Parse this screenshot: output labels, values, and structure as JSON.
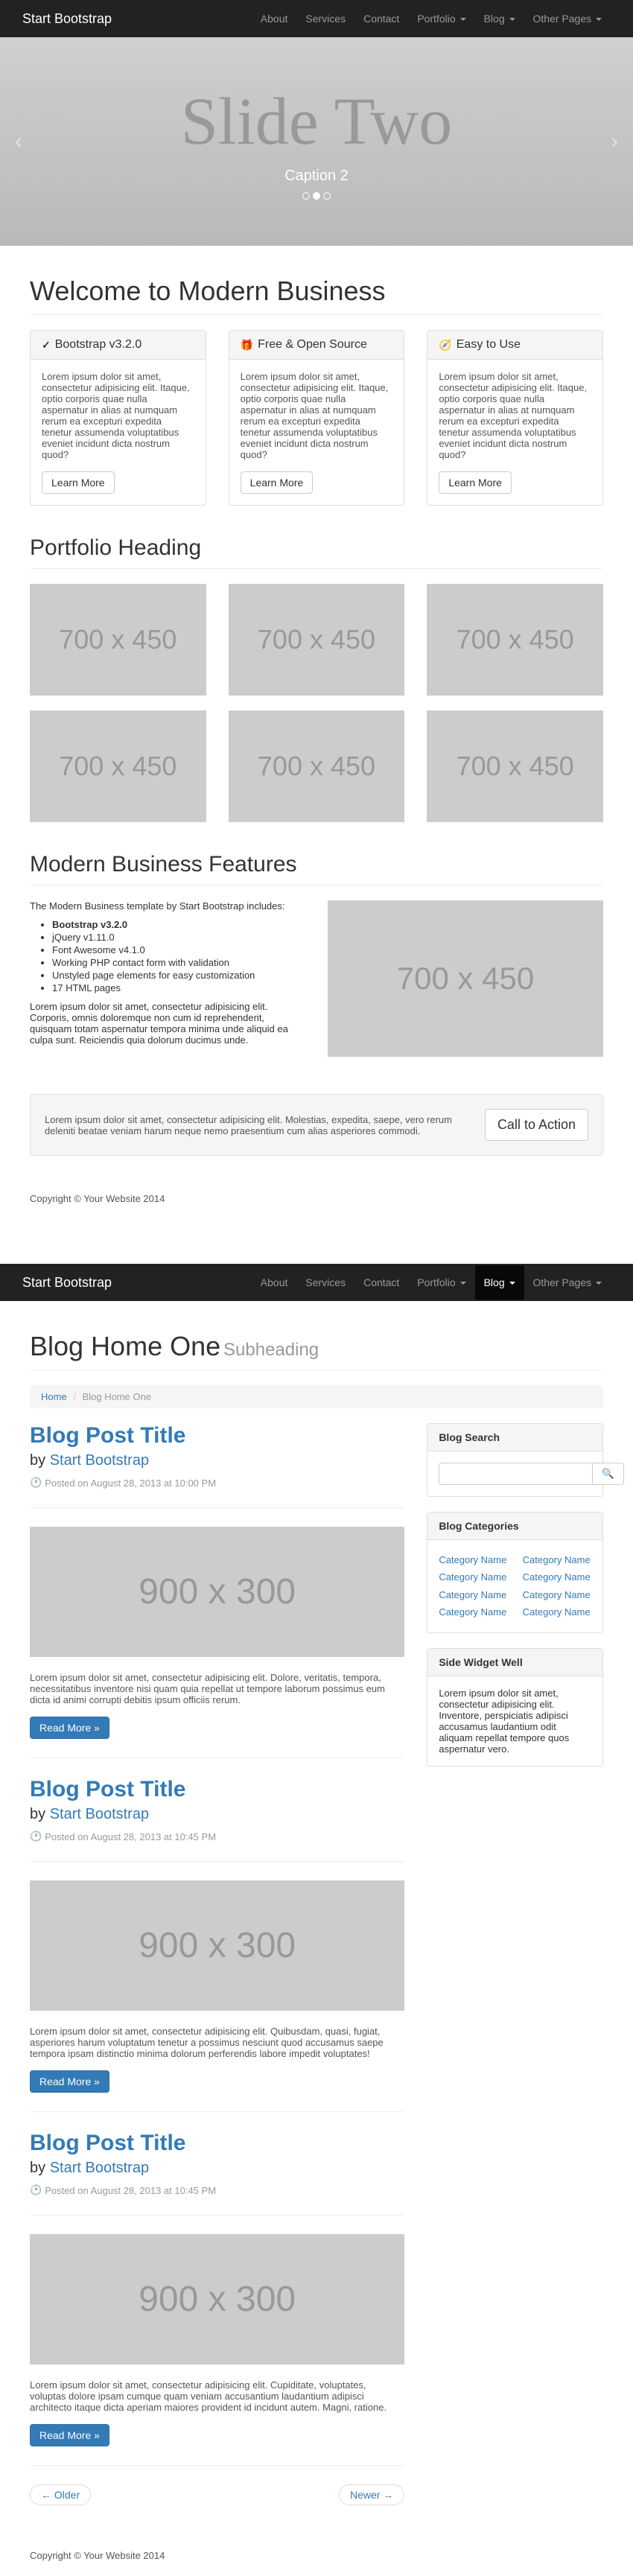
{
  "nav": {
    "brand": "Start Bootstrap",
    "items": [
      "About",
      "Services",
      "Contact",
      "Portfolio",
      "Blog",
      "Other Pages"
    ],
    "active_p1": 4
  },
  "carousel": {
    "title": "Slide Two",
    "caption": "Caption 2"
  },
  "welcome": {
    "heading": "Welcome to Modern Business"
  },
  "panels": [
    {
      "icon": "check",
      "title": "Bootstrap v3.2.0",
      "body": "Lorem ipsum dolor sit amet, consectetur adipisicing elit. Itaque, optio corporis quae nulla aspernatur in alias at numquam rerum ea excepturi expedita tenetur assumenda voluptatibus eveniet incidunt dicta nostrum quod?",
      "btn": "Learn More"
    },
    {
      "icon": "gift",
      "title": "Free & Open Source",
      "body": "Lorem ipsum dolor sit amet, consectetur adipisicing elit. Itaque, optio corporis quae nulla aspernatur in alias at numquam rerum ea excepturi expedita tenetur assumenda voluptatibus eveniet incidunt dicta nostrum quod?",
      "btn": "Learn More"
    },
    {
      "icon": "compass",
      "title": "Easy to Use",
      "body": "Lorem ipsum dolor sit amet, consectetur adipisicing elit. Itaque, optio corporis quae nulla aspernatur in alias at numquam rerum ea excepturi expedita tenetur assumenda voluptatibus eveniet incidunt dicta nostrum quod?",
      "btn": "Learn More"
    }
  ],
  "portfolio": {
    "heading": "Portfolio Heading",
    "placeholder": "700 x 450"
  },
  "features": {
    "heading": "Modern Business Features",
    "intro": "The Modern Business template by Start Bootstrap includes:",
    "list": [
      "Bootstrap v3.2.0",
      "jQuery v1.11.0",
      "Font Awesome v4.1.0",
      "Working PHP contact form with validation",
      "Unstyled page elements for easy customization",
      "17 HTML pages"
    ],
    "para": "Lorem ipsum dolor sit amet, consectetur adipisicing elit. Corporis, omnis doloremque non cum id reprehenderit, quisquam totam aspernatur tempora minima unde aliquid ea culpa sunt. Reiciendis quia dolorum ducimus unde.",
    "placeholder": "700 x 450"
  },
  "cta": {
    "text": "Lorem ipsum dolor sit amet, consectetur adipisicing elit. Molestias, expedita, saepe, vero rerum deleniti beatae veniam harum neque nemo praesentium cum alias asperiores commodi.",
    "btn": "Call to Action"
  },
  "footer": "Copyright © Your Website 2014",
  "blog": {
    "heading": "Blog Home One",
    "sub": "Subheading",
    "breadcrumb": {
      "home": "Home",
      "current": "Blog Home One"
    },
    "posts": [
      {
        "title": "Blog Post Title",
        "by": "by",
        "author": "Start Bootstrap",
        "date": "Posted on August 28, 2013 at 10:00 PM",
        "img": "900 x 300",
        "text": "Lorem ipsum dolor sit amet, consectetur adipisicing elit. Dolore, veritatis, tempora, necessitatibus inventore nisi quam quia repellat ut tempore laborum possimus eum dicta id animi corrupti debitis ipsum officiis rerum.",
        "btn": "Read More »"
      },
      {
        "title": "Blog Post Title",
        "by": "by",
        "author": "Start Bootstrap",
        "date": "Posted on August 28, 2013 at 10:45 PM",
        "img": "900 x 300",
        "text": "Lorem ipsum dolor sit amet, consectetur adipisicing elit. Quibusdam, quasi, fugiat, asperiores harum voluptatum tenetur a possimus nesciunt quod accusamus saepe tempora ipsam distinctio minima dolorum perferendis labore impedit voluptates!",
        "btn": "Read More »"
      },
      {
        "title": "Blog Post Title",
        "by": "by",
        "author": "Start Bootstrap",
        "date": "Posted on August 28, 2013 at 10:45 PM",
        "img": "900 x 300",
        "text": "Lorem ipsum dolor sit amet, consectetur adipisicing elit. Cupiditate, voluptates, voluptas dolore ipsam cumque quam veniam accusantium laudantium adipisci architecto itaque dicta aperiam maiores provident id incidunt autem. Magni, ratione.",
        "btn": "Read More »"
      }
    ],
    "pager": {
      "older": "← Older",
      "newer": "Newer →"
    },
    "search": {
      "heading": "Blog Search"
    },
    "categories": {
      "heading": "Blog Categories",
      "col1": [
        "Category Name",
        "Category Name",
        "Category Name",
        "Category Name"
      ],
      "col2": [
        "Category Name",
        "Category Name",
        "Category Name",
        "Category Name"
      ]
    },
    "widget": {
      "heading": "Side Widget Well",
      "body": "Lorem ipsum dolor sit amet, consectetur adipisicing elit. Inventore, perspiciatis adipisci accusamus laudantium odit aliquam repellat tempore quos aspernatur vero."
    }
  }
}
